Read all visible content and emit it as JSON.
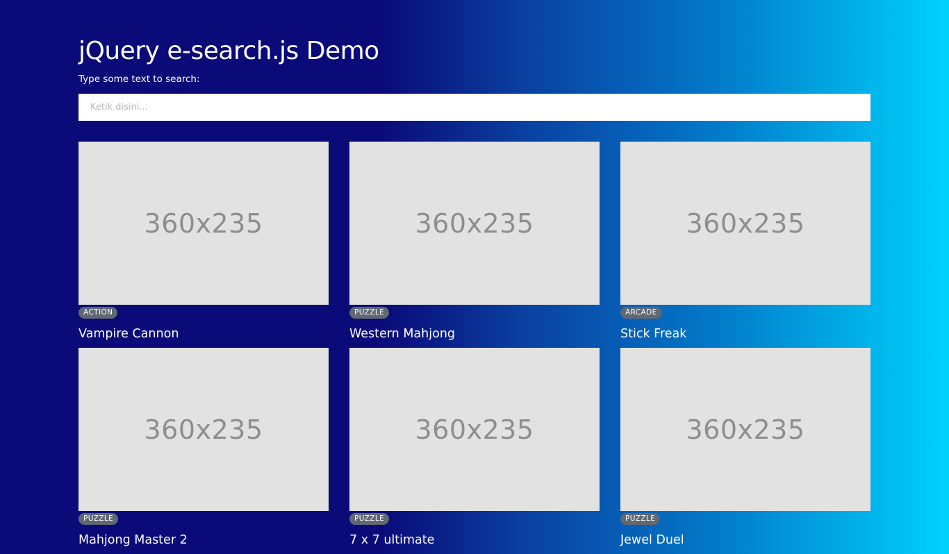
{
  "header": {
    "title": "jQuery e-search.js Demo",
    "search_label": "Type some text to search:"
  },
  "search": {
    "placeholder": "Ketik disini...",
    "value": ""
  },
  "colors": {
    "background_gradient": [
      "#0a0a78",
      "#0378c8",
      "#00d2fc"
    ],
    "badge": "#5f6873",
    "thumbnail": "#e2e2e2"
  },
  "games": [
    {
      "category": "ACTION",
      "title": "Vampire Cannon",
      "thumbnail": "360x235"
    },
    {
      "category": "PUZZLE",
      "title": "Western Mahjong",
      "thumbnail": "360x235"
    },
    {
      "category": "ARCADE",
      "title": "Stick Freak",
      "thumbnail": "360x235"
    },
    {
      "category": "PUZZLE",
      "title": "Mahjong Master 2",
      "thumbnail": "360x235"
    },
    {
      "category": "PUZZLE",
      "title": "7 x 7 ultimate",
      "thumbnail": "360x235"
    },
    {
      "category": "PUZZLE",
      "title": "Jewel Duel",
      "thumbnail": "360x235"
    }
  ]
}
